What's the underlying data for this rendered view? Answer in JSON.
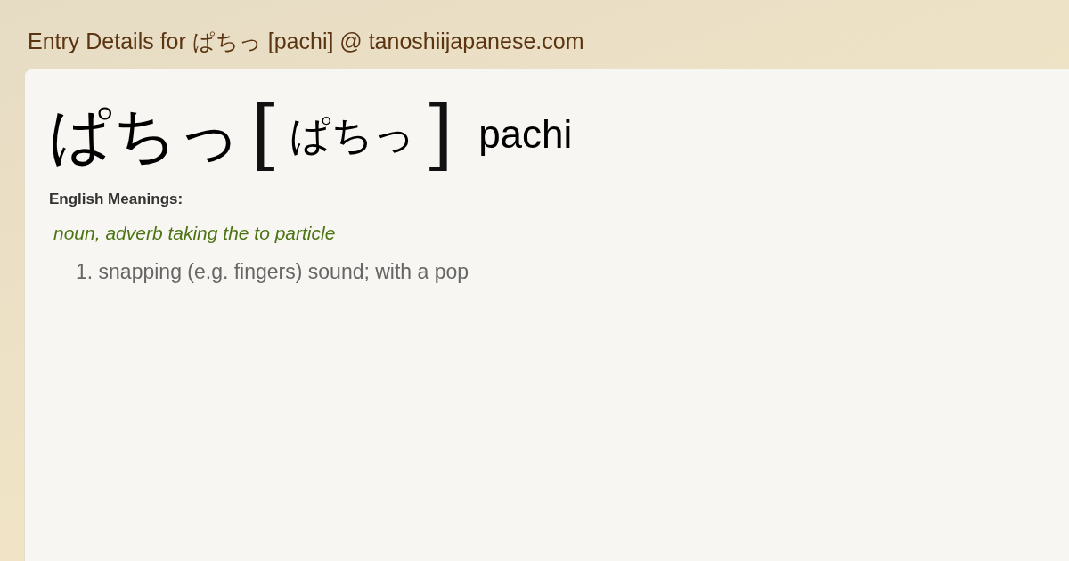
{
  "page_title": "Entry Details for ぱちっ [pachi] @ tanoshiijapanese.com",
  "entry": {
    "word": "ぱちっ",
    "bracket_open": "[",
    "reading": "ぱちっ",
    "bracket_close": "]",
    "romaji": "pachi"
  },
  "meanings_label": "English Meanings:",
  "part_of_speech": "noun, adverb taking the to particle",
  "senses": [
    {
      "number": "1.",
      "text": "snapping (e.g. fingers) sound; with a pop"
    }
  ]
}
